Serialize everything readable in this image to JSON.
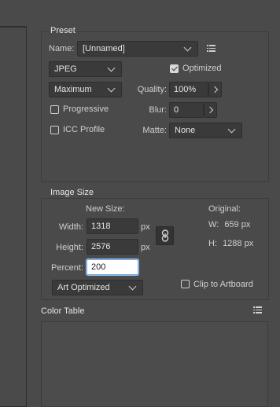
{
  "preset": {
    "title": "Preset",
    "name_label": "Name:",
    "name_value": "[Unnamed]",
    "format_value": "JPEG",
    "optimized_label": "Optimized",
    "optimized_checked": true,
    "quality_preset_value": "Maximum",
    "quality_label": "Quality:",
    "quality_value": "100%",
    "progressive_label": "Progressive",
    "progressive_checked": false,
    "blur_label": "Blur:",
    "blur_value": "0",
    "icc_label": "ICC Profile",
    "icc_checked": false,
    "matte_label": "Matte:",
    "matte_value": "None"
  },
  "image_size": {
    "title": "Image Size",
    "new_size_label": "New Size:",
    "width_label": "Width:",
    "width_value": "1318",
    "width_unit": "px",
    "height_label": "Height:",
    "height_value": "2576",
    "height_unit": "px",
    "percent_label": "Percent:",
    "percent_value": "200",
    "resample_value": "Art Optimized",
    "original_label": "Original:",
    "orig_w_label": "W:",
    "orig_w_value": "659 px",
    "orig_h_label": "H:",
    "orig_h_value": "1288 px",
    "clip_label": "Clip to Artboard",
    "clip_checked": false
  },
  "color_table": {
    "title": "Color Table"
  }
}
